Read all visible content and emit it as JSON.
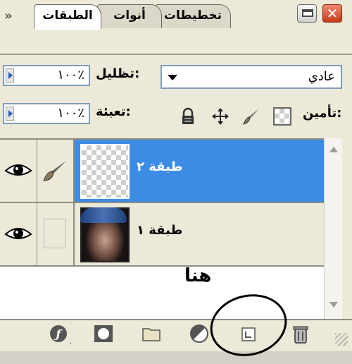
{
  "window": {
    "minimize_label": "minimize",
    "close_glyph": "✕"
  },
  "tabs": {
    "overflow": "»",
    "items": [
      {
        "label": "تخطيطات",
        "active": false
      },
      {
        "label": "أنوات",
        "active": false
      },
      {
        "label": "الطبقات",
        "active": true
      }
    ]
  },
  "controls": {
    "opacity_label": "تظليل:",
    "opacity_value": "١٠٠٪",
    "blend_mode": "عادي",
    "fill_label": "تعبئة:",
    "fill_value": "١٠٠٪",
    "lock_label": "تأمين:",
    "lock_icons": [
      "lock-transparent-icon",
      "lock-paint-icon",
      "lock-move-icon",
      "lock-all-icon"
    ]
  },
  "layers": [
    {
      "name": "طبقة ٢",
      "selected": true,
      "visible": true,
      "thumb": "transparent"
    },
    {
      "name": "طبقة ١",
      "selected": false,
      "visible": true,
      "thumb": "photo"
    }
  ],
  "bottom_icons": [
    "layer-style-icon",
    "layer-mask-icon",
    "new-group-icon",
    "adjustment-layer-icon",
    "new-layer-icon",
    "trash-icon"
  ],
  "annotation": {
    "text": "هنا"
  },
  "colors": {
    "selection": "#3c8ce6",
    "panel": "#ece9d8",
    "close": "#c6391a"
  }
}
